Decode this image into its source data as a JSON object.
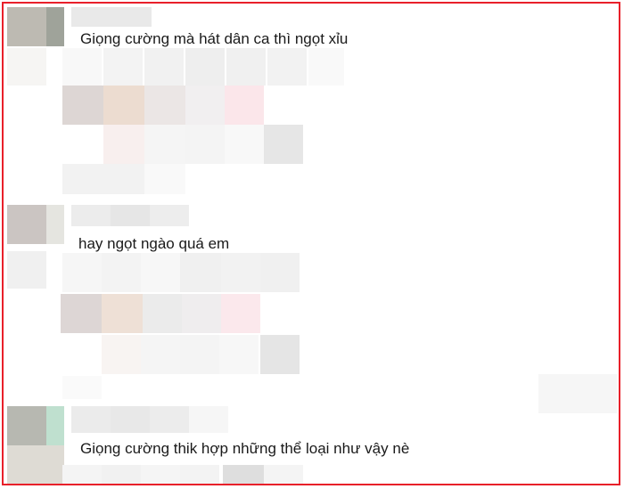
{
  "comments": [
    {
      "text": "Giọng cường mà hát dân ca thì ngọt xỉu"
    },
    {
      "text": "hay ngọt ngào quá em"
    },
    {
      "text": "Giọng cường thik hợp những thể loại như vậy nè"
    }
  ],
  "colors": {
    "border": "#e8202a",
    "blur_gray": "#eeeeee",
    "blur_pink": "#fbe6ea",
    "blur_beige": "#ecdcd0"
  }
}
